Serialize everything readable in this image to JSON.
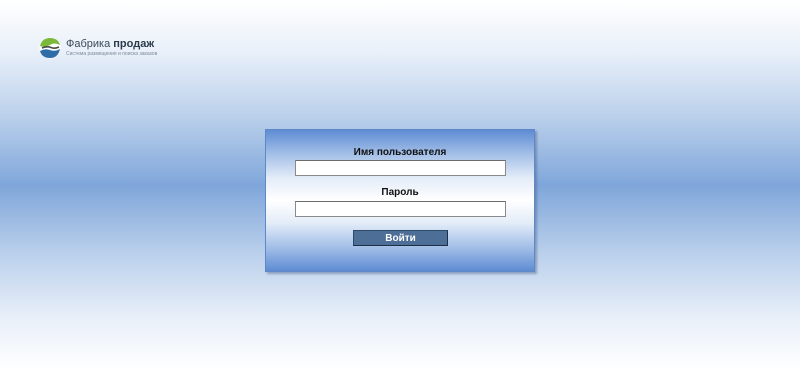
{
  "branding": {
    "title_regular": "Фабрика",
    "title_bold": "продаж",
    "subtitle": "Система размещения и поиска заказов",
    "icon": "globe-logo-icon"
  },
  "login": {
    "username_label": "Имя пользователя",
    "username_value": "",
    "password_label": "Пароль",
    "password_value": "",
    "submit_label": "Войти"
  },
  "colors": {
    "background_center": "#7fa6da",
    "panel_edge": "#5e8cd3",
    "button": "#4d6f97",
    "logo_green": "#7cb93b",
    "logo_blue": "#2f6da8"
  }
}
